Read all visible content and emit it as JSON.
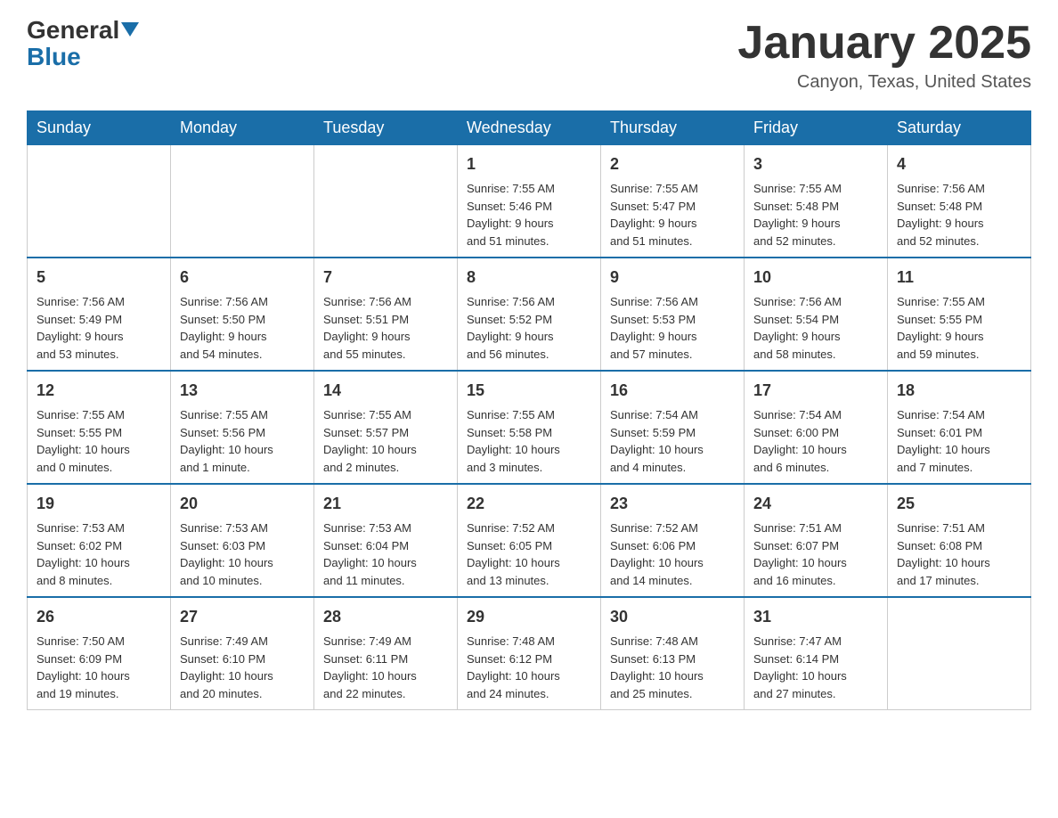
{
  "header": {
    "logo": {
      "general": "General",
      "blue": "Blue"
    },
    "title": "January 2025",
    "location": "Canyon, Texas, United States"
  },
  "days": [
    "Sunday",
    "Monday",
    "Tuesday",
    "Wednesday",
    "Thursday",
    "Friday",
    "Saturday"
  ],
  "weeks": [
    [
      {
        "day": "",
        "info": ""
      },
      {
        "day": "",
        "info": ""
      },
      {
        "day": "",
        "info": ""
      },
      {
        "day": "1",
        "info": "Sunrise: 7:55 AM\nSunset: 5:46 PM\nDaylight: 9 hours\nand 51 minutes."
      },
      {
        "day": "2",
        "info": "Sunrise: 7:55 AM\nSunset: 5:47 PM\nDaylight: 9 hours\nand 51 minutes."
      },
      {
        "day": "3",
        "info": "Sunrise: 7:55 AM\nSunset: 5:48 PM\nDaylight: 9 hours\nand 52 minutes."
      },
      {
        "day": "4",
        "info": "Sunrise: 7:56 AM\nSunset: 5:48 PM\nDaylight: 9 hours\nand 52 minutes."
      }
    ],
    [
      {
        "day": "5",
        "info": "Sunrise: 7:56 AM\nSunset: 5:49 PM\nDaylight: 9 hours\nand 53 minutes."
      },
      {
        "day": "6",
        "info": "Sunrise: 7:56 AM\nSunset: 5:50 PM\nDaylight: 9 hours\nand 54 minutes."
      },
      {
        "day": "7",
        "info": "Sunrise: 7:56 AM\nSunset: 5:51 PM\nDaylight: 9 hours\nand 55 minutes."
      },
      {
        "day": "8",
        "info": "Sunrise: 7:56 AM\nSunset: 5:52 PM\nDaylight: 9 hours\nand 56 minutes."
      },
      {
        "day": "9",
        "info": "Sunrise: 7:56 AM\nSunset: 5:53 PM\nDaylight: 9 hours\nand 57 minutes."
      },
      {
        "day": "10",
        "info": "Sunrise: 7:56 AM\nSunset: 5:54 PM\nDaylight: 9 hours\nand 58 minutes."
      },
      {
        "day": "11",
        "info": "Sunrise: 7:55 AM\nSunset: 5:55 PM\nDaylight: 9 hours\nand 59 minutes."
      }
    ],
    [
      {
        "day": "12",
        "info": "Sunrise: 7:55 AM\nSunset: 5:55 PM\nDaylight: 10 hours\nand 0 minutes."
      },
      {
        "day": "13",
        "info": "Sunrise: 7:55 AM\nSunset: 5:56 PM\nDaylight: 10 hours\nand 1 minute."
      },
      {
        "day": "14",
        "info": "Sunrise: 7:55 AM\nSunset: 5:57 PM\nDaylight: 10 hours\nand 2 minutes."
      },
      {
        "day": "15",
        "info": "Sunrise: 7:55 AM\nSunset: 5:58 PM\nDaylight: 10 hours\nand 3 minutes."
      },
      {
        "day": "16",
        "info": "Sunrise: 7:54 AM\nSunset: 5:59 PM\nDaylight: 10 hours\nand 4 minutes."
      },
      {
        "day": "17",
        "info": "Sunrise: 7:54 AM\nSunset: 6:00 PM\nDaylight: 10 hours\nand 6 minutes."
      },
      {
        "day": "18",
        "info": "Sunrise: 7:54 AM\nSunset: 6:01 PM\nDaylight: 10 hours\nand 7 minutes."
      }
    ],
    [
      {
        "day": "19",
        "info": "Sunrise: 7:53 AM\nSunset: 6:02 PM\nDaylight: 10 hours\nand 8 minutes."
      },
      {
        "day": "20",
        "info": "Sunrise: 7:53 AM\nSunset: 6:03 PM\nDaylight: 10 hours\nand 10 minutes."
      },
      {
        "day": "21",
        "info": "Sunrise: 7:53 AM\nSunset: 6:04 PM\nDaylight: 10 hours\nand 11 minutes."
      },
      {
        "day": "22",
        "info": "Sunrise: 7:52 AM\nSunset: 6:05 PM\nDaylight: 10 hours\nand 13 minutes."
      },
      {
        "day": "23",
        "info": "Sunrise: 7:52 AM\nSunset: 6:06 PM\nDaylight: 10 hours\nand 14 minutes."
      },
      {
        "day": "24",
        "info": "Sunrise: 7:51 AM\nSunset: 6:07 PM\nDaylight: 10 hours\nand 16 minutes."
      },
      {
        "day": "25",
        "info": "Sunrise: 7:51 AM\nSunset: 6:08 PM\nDaylight: 10 hours\nand 17 minutes."
      }
    ],
    [
      {
        "day": "26",
        "info": "Sunrise: 7:50 AM\nSunset: 6:09 PM\nDaylight: 10 hours\nand 19 minutes."
      },
      {
        "day": "27",
        "info": "Sunrise: 7:49 AM\nSunset: 6:10 PM\nDaylight: 10 hours\nand 20 minutes."
      },
      {
        "day": "28",
        "info": "Sunrise: 7:49 AM\nSunset: 6:11 PM\nDaylight: 10 hours\nand 22 minutes."
      },
      {
        "day": "29",
        "info": "Sunrise: 7:48 AM\nSunset: 6:12 PM\nDaylight: 10 hours\nand 24 minutes."
      },
      {
        "day": "30",
        "info": "Sunrise: 7:48 AM\nSunset: 6:13 PM\nDaylight: 10 hours\nand 25 minutes."
      },
      {
        "day": "31",
        "info": "Sunrise: 7:47 AM\nSunset: 6:14 PM\nDaylight: 10 hours\nand 27 minutes."
      },
      {
        "day": "",
        "info": ""
      }
    ]
  ]
}
